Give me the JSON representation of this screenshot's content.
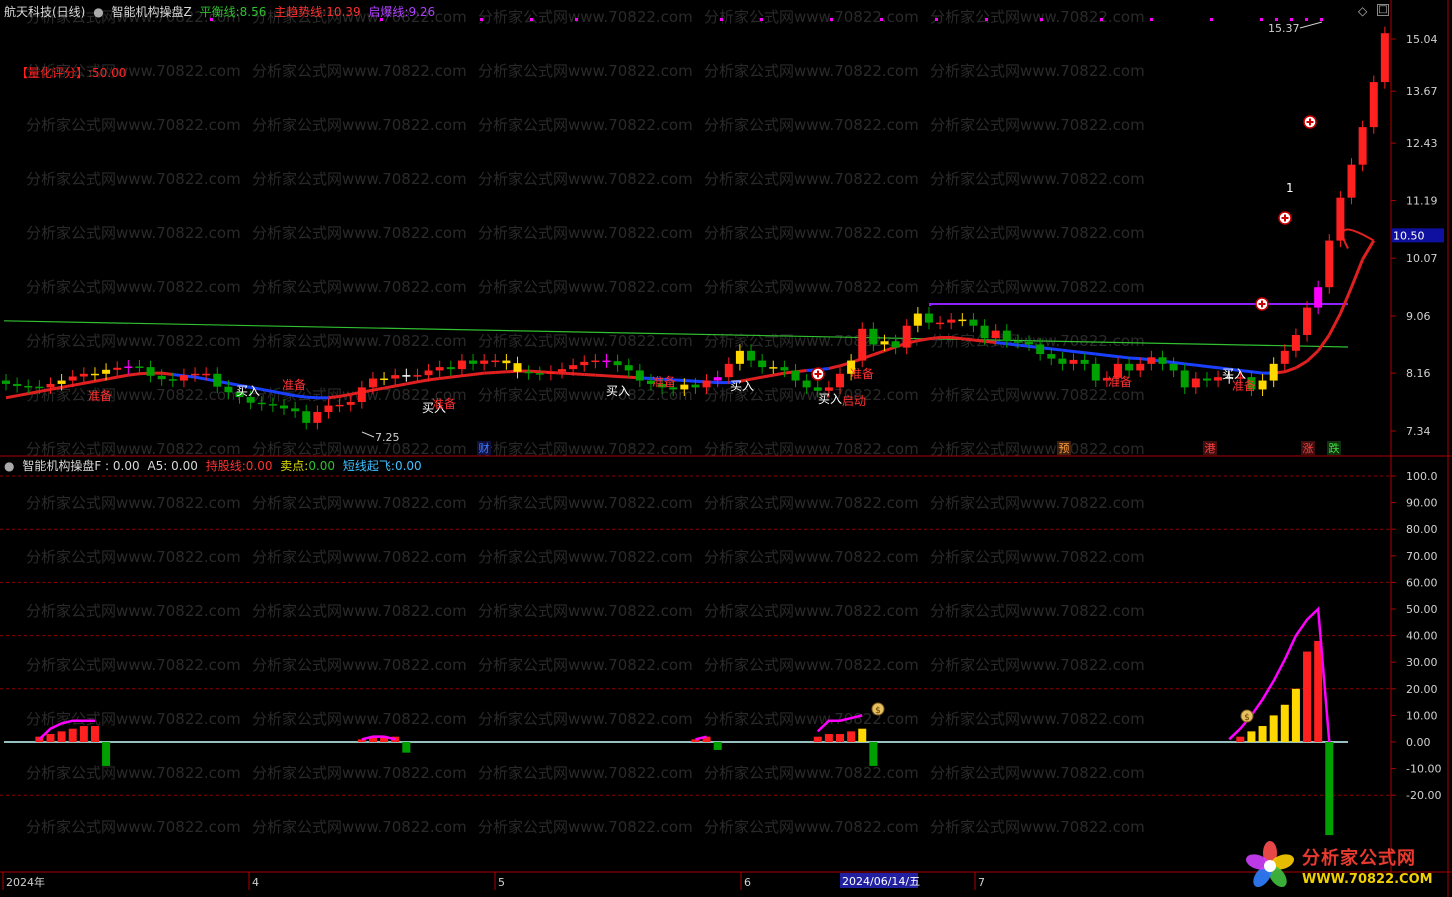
{
  "top_header": {
    "stock": "航天科技(日线)",
    "indicator": "智能机构操盘Z",
    "balance_label": "平衡线:",
    "balance_value": "8.56",
    "trend_label": "主趋势线:",
    "trend_value": "10.39",
    "start_label": "启爆线:",
    "start_value": "9.26",
    "score_text": "【量化评分】:50.00"
  },
  "bottom_header": {
    "indicator": "智能机构操盘F",
    "f_text": ": 0.00",
    "a5_text": "A5: 0.00",
    "hold_label": "持股线:",
    "hold_value": "0.00",
    "sell_label": "卖点:",
    "sell_value": "0.00",
    "fly_label": "短线起飞:",
    "fly_value": "0.00"
  },
  "watermark": "分析家公式网www.70822.com",
  "logo": {
    "name": "分析家公式网",
    "url": "WWW.70822.COM"
  },
  "colors": {
    "up": "#ff2020",
    "down": "#00a000",
    "yellow": "#ffd800",
    "magenta": "#ff00ff",
    "trend_red": "#e02020",
    "trend_blue": "#1a40ff",
    "green_line": "#30c030",
    "purple_line": "#9020ff",
    "grid": "#8b0000"
  },
  "price_axis_labels": [
    "15.04",
    "13.67",
    "12.43",
    "11.19",
    "10.07",
    "9.06",
    "8.16",
    "7.34"
  ],
  "current_price_label": "10.50",
  "osc_axis_labels": [
    "100.0",
    "90.00",
    "80.00",
    "70.00",
    "60.00",
    "50.00",
    "40.00",
    "30.00",
    "20.00",
    "10.00",
    "0.00",
    "-10.00",
    "-20.00"
  ],
  "date_axis": {
    "labels": [
      "2024年",
      "4",
      "5",
      "6",
      "7"
    ],
    "cursor_date": "2024/06/14/五"
  },
  "annotations": {
    "high": "15.37",
    "low": "7.25",
    "one": "1",
    "buy": "买入",
    "prepare": "准备",
    "start": "启动",
    "events": [
      "财",
      "预",
      "港",
      "涨",
      "跌"
    ]
  },
  "chart_data": {
    "type": "candlestick",
    "y_range": [
      7.0,
      15.6
    ],
    "osc_range": [
      -35,
      105
    ],
    "open": [
      8.05,
      8.0,
      7.97,
      7.96,
      7.95,
      8.0,
      8.05,
      8.11,
      8.15,
      8.15,
      8.21,
      8.24,
      8.26,
      8.25,
      8.12,
      8.07,
      8.05,
      8.13,
      8.15,
      8.15,
      7.96,
      7.88,
      7.81,
      7.73,
      7.71,
      7.69,
      7.65,
      7.61,
      7.45,
      7.6,
      7.69,
      7.7,
      7.74,
      7.95,
      8.08,
      8.08,
      8.13,
      8.13,
      8.13,
      8.2,
      8.25,
      8.22,
      8.35,
      8.3,
      8.35,
      8.35,
      8.31,
      8.18,
      8.16,
      8.15,
      8.18,
      8.22,
      8.28,
      8.33,
      8.35,
      8.34,
      8.28,
      8.2,
      8.05,
      8.0,
      7.95,
      7.92,
      7.99,
      7.95,
      8.05,
      8.1,
      8.3,
      8.5,
      8.35,
      8.25,
      8.25,
      8.2,
      8.05,
      7.95,
      7.9,
      7.95,
      8.15,
      8.35,
      8.85,
      8.6,
      8.65,
      8.55,
      8.9,
      9.1,
      8.95,
      8.95,
      9.0,
      9.0,
      8.9,
      8.7,
      8.82,
      8.65,
      8.64,
      8.6,
      8.45,
      8.38,
      8.3,
      8.36,
      8.3,
      8.05,
      8.09,
      8.3,
      8.2,
      8.3,
      8.4,
      8.3,
      8.2,
      7.95,
      8.08,
      8.05,
      8.1,
      8.1,
      8.1,
      7.92,
      8.05,
      8.3,
      8.5,
      8.75,
      9.2,
      9.55,
      10.4,
      11.25,
      11.95,
      12.8,
      13.9
    ],
    "close": [
      8.0,
      7.97,
      7.96,
      7.95,
      8.0,
      8.05,
      8.11,
      8.15,
      8.15,
      8.21,
      8.24,
      8.26,
      8.25,
      8.12,
      8.07,
      8.05,
      8.13,
      8.15,
      8.15,
      7.96,
      7.88,
      7.81,
      7.73,
      7.71,
      7.69,
      7.65,
      7.61,
      7.45,
      7.6,
      7.69,
      7.7,
      7.74,
      7.95,
      8.08,
      8.08,
      8.13,
      8.13,
      8.13,
      8.2,
      8.25,
      8.22,
      8.35,
      8.3,
      8.35,
      8.35,
      8.31,
      8.18,
      8.16,
      8.15,
      8.18,
      8.22,
      8.28,
      8.33,
      8.35,
      8.34,
      8.28,
      8.2,
      8.05,
      8.0,
      7.95,
      7.92,
      7.99,
      7.95,
      8.05,
      8.1,
      8.3,
      8.5,
      8.35,
      8.25,
      8.25,
      8.2,
      8.05,
      7.95,
      7.9,
      7.95,
      8.15,
      8.35,
      8.85,
      8.6,
      8.65,
      8.55,
      8.9,
      9.1,
      8.95,
      8.95,
      9.0,
      9.0,
      8.9,
      8.7,
      8.82,
      8.65,
      8.64,
      8.6,
      8.45,
      8.38,
      8.3,
      8.36,
      8.3,
      8.05,
      8.09,
      8.3,
      8.2,
      8.3,
      8.4,
      8.3,
      8.2,
      7.95,
      8.08,
      8.05,
      8.1,
      8.1,
      8.1,
      7.92,
      8.05,
      8.3,
      8.5,
      8.75,
      9.2,
      9.55,
      10.4,
      11.25,
      11.95,
      12.8,
      13.9,
      15.2
    ],
    "trend_line": [
      7.8,
      7.83,
      7.86,
      7.89,
      7.92,
      7.95,
      7.98,
      8.01,
      8.04,
      8.07,
      8.1,
      8.13,
      8.15,
      8.16,
      8.16,
      8.14,
      8.12,
      8.1,
      8.07,
      8.04,
      8.01,
      7.98,
      7.95,
      7.92,
      7.89,
      7.86,
      7.83,
      7.81,
      7.8,
      7.8,
      7.82,
      7.85,
      7.88,
      7.91,
      7.94,
      7.97,
      8.0,
      8.03,
      8.06,
      8.08,
      8.1,
      8.12,
      8.14,
      8.16,
      8.17,
      8.18,
      8.19,
      8.19,
      8.18,
      8.17,
      8.16,
      8.15,
      8.14,
      8.13,
      8.12,
      8.11,
      8.1,
      8.09,
      8.08,
      8.07,
      8.06,
      8.05,
      8.04,
      8.03,
      8.02,
      8.02,
      8.04,
      8.07,
      8.1,
      8.13,
      8.16,
      8.18,
      8.2,
      8.21,
      8.23,
      8.27,
      8.32,
      8.38,
      8.44,
      8.5,
      8.56,
      8.62,
      8.66,
      8.69,
      8.71,
      8.71,
      8.69,
      8.67,
      8.65,
      8.63,
      8.61,
      8.59,
      8.57,
      8.55,
      8.53,
      8.51,
      8.49,
      8.47,
      8.45,
      8.43,
      8.41,
      8.39,
      8.38,
      8.36,
      8.34,
      8.32,
      8.3,
      8.28,
      8.26,
      8.24,
      8.22,
      8.2,
      8.18,
      8.16,
      8.16,
      8.18,
      8.24,
      8.34,
      8.5,
      8.75,
      9.1,
      9.55,
      10.05,
      10.4
    ],
    "trend_color": [
      "r",
      "r",
      "r",
      "r",
      "r",
      "r",
      "r",
      "r",
      "r",
      "r",
      "r",
      "r",
      "r",
      "r",
      "r",
      "b",
      "b",
      "b",
      "b",
      "b",
      "b",
      "b",
      "b",
      "b",
      "b",
      "b",
      "b",
      "b",
      "b",
      "r",
      "r",
      "r",
      "r",
      "r",
      "r",
      "r",
      "r",
      "r",
      "r",
      "r",
      "r",
      "r",
      "r",
      "r",
      "r",
      "r",
      "r",
      "r",
      "r",
      "r",
      "r",
      "r",
      "r",
      "r",
      "r",
      "r",
      "r",
      "b",
      "b",
      "b",
      "b",
      "b",
      "b",
      "b",
      "b",
      "b",
      "r",
      "r",
      "r",
      "r",
      "r",
      "r",
      "b",
      "b",
      "r",
      "r",
      "r",
      "r",
      "r",
      "r",
      "r",
      "r",
      "r",
      "r",
      "r",
      "r",
      "r",
      "r",
      "r",
      "b",
      "b",
      "b",
      "b",
      "b",
      "b",
      "b",
      "b",
      "b",
      "b",
      "b",
      "b",
      "b",
      "b",
      "b",
      "b",
      "b",
      "b",
      "b",
      "b",
      "b",
      "b",
      "b",
      "b",
      "b",
      "r",
      "r",
      "r",
      "r",
      "r",
      "r",
      "r",
      "r",
      "r",
      "r",
      "r"
    ],
    "balance_line_start": 8.98,
    "balance_line_end": 8.56,
    "start_line": 9.26,
    "osc_bars": [
      {
        "i": 3,
        "v": 2,
        "c": "r"
      },
      {
        "i": 4,
        "v": 3,
        "c": "r"
      },
      {
        "i": 5,
        "v": 4,
        "c": "r"
      },
      {
        "i": 6,
        "v": 5,
        "c": "r"
      },
      {
        "i": 7,
        "v": 6,
        "c": "r"
      },
      {
        "i": 8,
        "v": 6,
        "c": "r"
      },
      {
        "i": 9,
        "v": -9,
        "c": "g"
      },
      {
        "i": 32,
        "v": 1,
        "c": "r"
      },
      {
        "i": 33,
        "v": 2,
        "c": "r"
      },
      {
        "i": 34,
        "v": 2,
        "c": "r"
      },
      {
        "i": 35,
        "v": 2,
        "c": "r"
      },
      {
        "i": 36,
        "v": -4,
        "c": "g"
      },
      {
        "i": 62,
        "v": 1,
        "c": "r"
      },
      {
        "i": 63,
        "v": 2,
        "c": "r"
      },
      {
        "i": 64,
        "v": -3,
        "c": "g"
      },
      {
        "i": 73,
        "v": 2,
        "c": "r"
      },
      {
        "i": 74,
        "v": 3,
        "c": "r"
      },
      {
        "i": 75,
        "v": 3,
        "c": "r"
      },
      {
        "i": 76,
        "v": 4,
        "c": "r"
      },
      {
        "i": 77,
        "v": 5,
        "c": "y"
      },
      {
        "i": 78,
        "v": -9,
        "c": "g"
      },
      {
        "i": 111,
        "v": 2,
        "c": "r"
      },
      {
        "i": 112,
        "v": 4,
        "c": "y"
      },
      {
        "i": 113,
        "v": 6,
        "c": "y"
      },
      {
        "i": 114,
        "v": 10,
        "c": "y"
      },
      {
        "i": 115,
        "v": 14,
        "c": "y"
      },
      {
        "i": 116,
        "v": 20,
        "c": "y"
      },
      {
        "i": 117,
        "v": 34,
        "c": "r"
      },
      {
        "i": 118,
        "v": 38,
        "c": "r"
      },
      {
        "i": 119,
        "v": -35,
        "c": "g"
      }
    ],
    "osc_lines": [
      {
        "from": 3,
        "values": [
          1,
          5,
          7,
          8,
          8,
          8
        ]
      },
      {
        "from": 32,
        "values": [
          1,
          2,
          2,
          1
        ]
      },
      {
        "from": 62,
        "values": [
          1,
          2
        ]
      },
      {
        "from": 73,
        "values": [
          4,
          8,
          8,
          9,
          10
        ]
      },
      {
        "from": 110,
        "values": [
          1,
          5,
          10,
          16,
          23,
          31,
          40,
          46,
          50,
          0
        ]
      }
    ]
  }
}
